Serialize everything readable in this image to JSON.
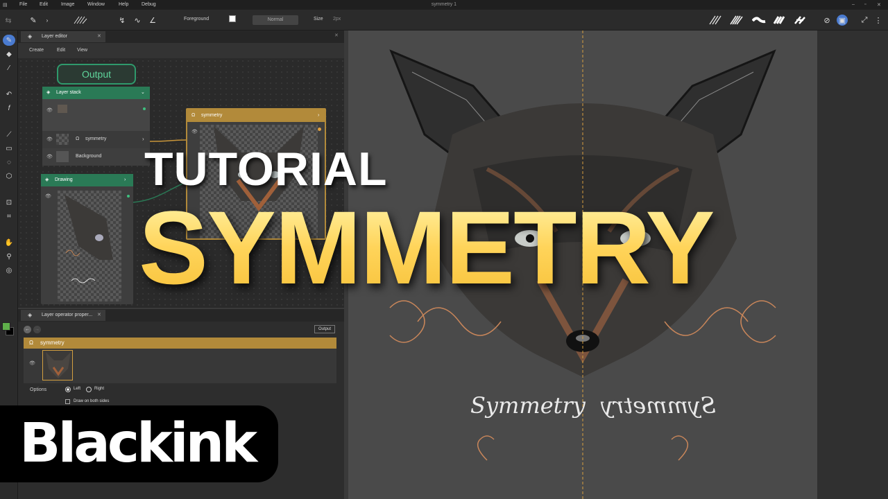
{
  "menubar": {
    "items": [
      "File",
      "Edit",
      "Image",
      "Window",
      "Help",
      "Debug"
    ],
    "title": "symmetry 1"
  },
  "toolbar": {
    "color_label": "Foreground",
    "blend_mode": "Normal",
    "size_label": "Size",
    "size_value": "2px"
  },
  "layer_editor": {
    "tab_title": "Layer editor",
    "menu": [
      "Create",
      "Edit",
      "View"
    ],
    "output_node": "Output",
    "layer_stack": {
      "title": "Layer stack",
      "layers": [
        "symmetry",
        "Background"
      ]
    },
    "symmetry_node": {
      "title": "symmetry"
    },
    "drawing_node": {
      "title": "Drawing"
    }
  },
  "properties": {
    "tab_title": "Layer operator proper...",
    "output_button": "Output",
    "header": "symmetry",
    "options_label": "Options",
    "radio_left": "Left",
    "radio_right": "Right",
    "radio_selected": "Left",
    "checkbox_label": "Draw on both sides",
    "checkbox_checked": false
  },
  "canvas": {
    "script_text": "Symmetry"
  },
  "overlay": {
    "subtitle": "TUTORIAL",
    "title": "SYMMETRY",
    "brand": "Blackink"
  },
  "colors": {
    "accent_gold": "#b28a3a",
    "node_green": "#2a7a56",
    "title_yellow": "#ffd45a",
    "foreground_swatch": "#5fae4a"
  }
}
